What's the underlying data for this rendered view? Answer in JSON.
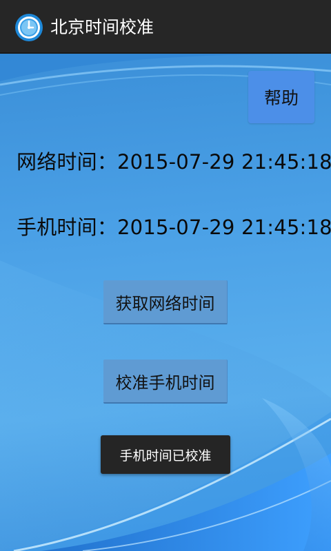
{
  "app": {
    "title": "北京时间校准",
    "icon": "clock-icon",
    "accent_color": "#3b8fd8"
  },
  "help": {
    "label": "帮助"
  },
  "network_time": {
    "label": "网络时间：",
    "value": "2015-07-29 21:45:18"
  },
  "phone_time": {
    "label": "手机时间：",
    "value": "2015-07-29 21:45:18"
  },
  "buttons": {
    "get_network_time": "获取网络时间",
    "calibrate_phone_time": "校准手机时间"
  },
  "toast": {
    "message": "手机时间已校准"
  }
}
